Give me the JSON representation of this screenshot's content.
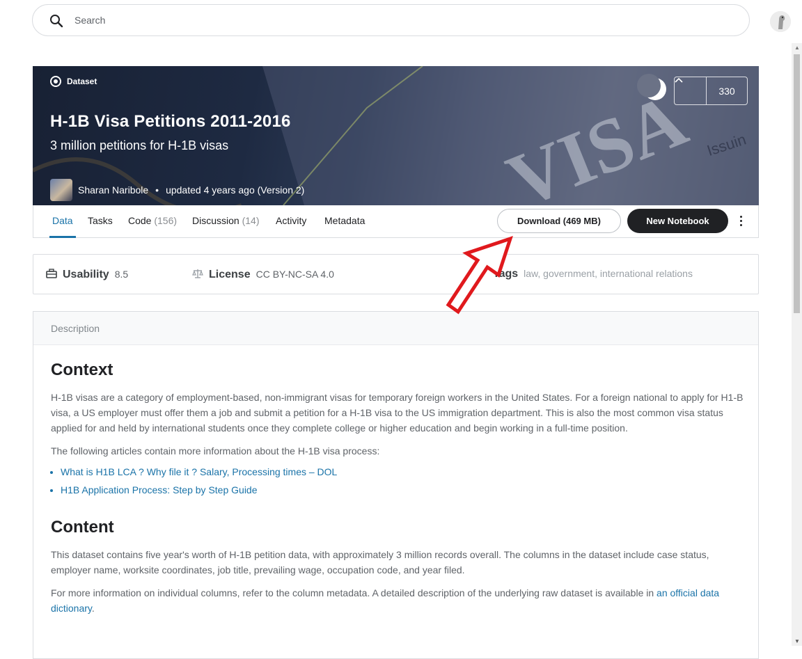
{
  "search": {
    "placeholder": "Search"
  },
  "dataset": {
    "type_label": "Dataset",
    "title": "H-1B Visa Petitions 2011-2016",
    "subtitle": "3 million petitions for H-1B visas",
    "owner": "Sharan Naribole",
    "bullet": "•",
    "updated": "updated 4 years ago (Version 2)",
    "votes": "330"
  },
  "tabs": [
    {
      "label": "Data",
      "count": ""
    },
    {
      "label": "Tasks",
      "count": ""
    },
    {
      "label": "Code",
      "count": "(156)"
    },
    {
      "label": "Discussion",
      "count": "(14)"
    },
    {
      "label": "Activity",
      "count": ""
    },
    {
      "label": "Metadata",
      "count": ""
    }
  ],
  "actions": {
    "download": "Download (469 MB)",
    "new_notebook": "New Notebook"
  },
  "info": {
    "usability_label": "Usability",
    "usability_value": "8.5",
    "license_label": "License",
    "license_value": "CC BY-NC-SA 4.0",
    "tags_label": "Tags",
    "tags": [
      "law",
      "government",
      "international relations"
    ],
    "tags_sep": ", "
  },
  "description": {
    "header": "Description",
    "context_heading": "Context",
    "context_p1": "H-1B visas are a category of employment-based, non-immigrant visas for temporary foreign workers in the United States. For a foreign national to apply for H1-B visa, a US employer must offer them a job and submit a petition for a H-1B visa to the US immigration department. This is also the most common visa status applied for and held by international students once they complete college or higher education and begin working in a full-time position.",
    "context_p2": "The following articles contain more information about the H-1B visa process:",
    "links": [
      "What is H1B LCA ? Why file it ? Salary, Processing times – DOL",
      "H1B Application Process: Step by Step Guide"
    ],
    "content_heading": "Content",
    "content_p1": "This dataset contains five year's worth of H-1B petition data, with approximately 3 million records overall. The columns in the dataset include case status, employer name, worksite coordinates, job title, prevailing wage, occupation code, and year filed.",
    "content_p2_prefix": "For more information on individual columns, refer to the column metadata. A detailed description of the underlying raw dataset is available in ",
    "content_p2_link": "an official data dictionary",
    "content_p2_suffix": "."
  },
  "colors": {
    "accent": "#1a73a8",
    "annotation_arrow": "#e0191d",
    "dark_button": "#202124"
  }
}
